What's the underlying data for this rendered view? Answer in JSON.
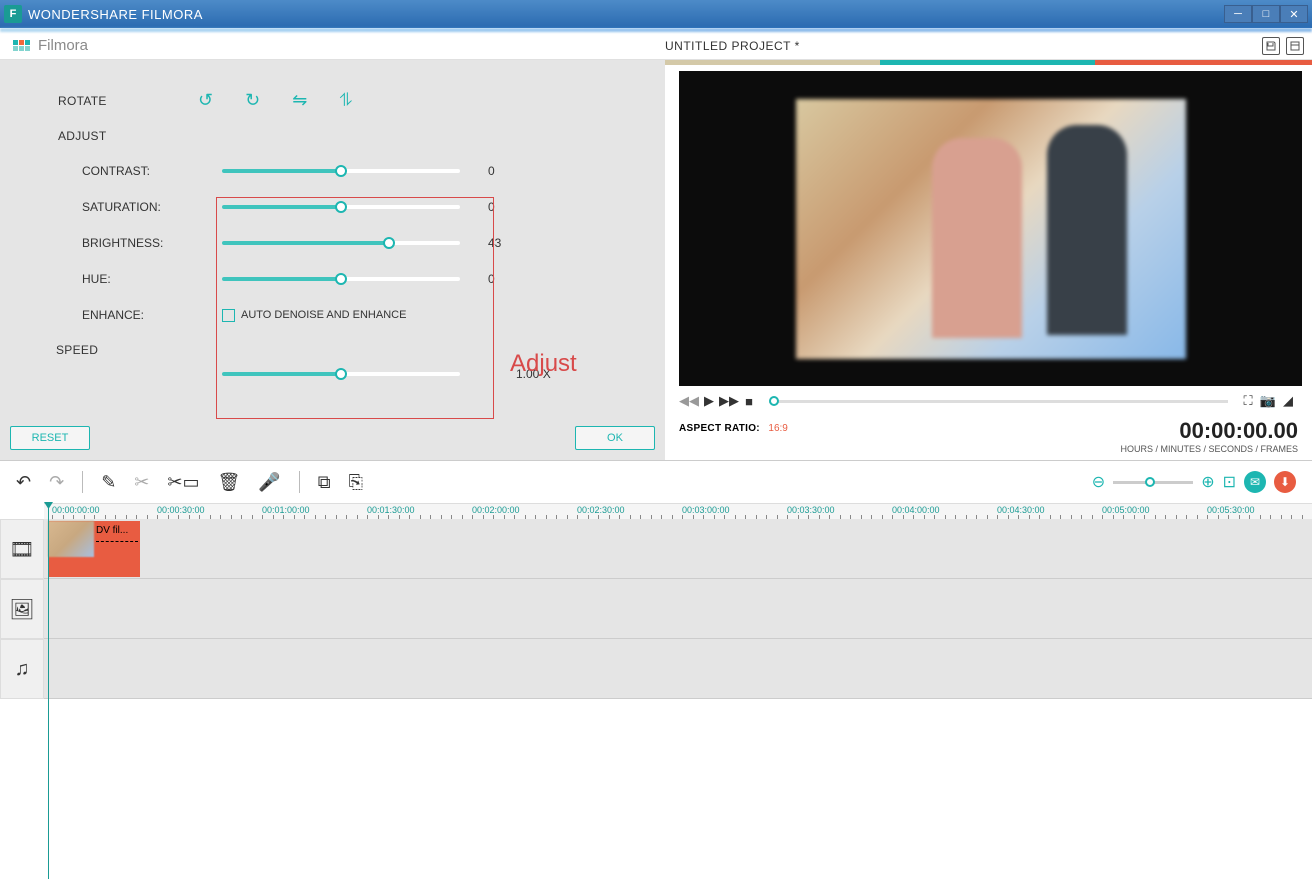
{
  "titlebar": {
    "app_name": "WONDERSHARE FILMORA"
  },
  "logo": {
    "text": "Filmora"
  },
  "project": {
    "title": "UNTITLED PROJECT *"
  },
  "sections": {
    "rotate": "ROTATE",
    "adjust": "ADJUST",
    "speed": "SPEED"
  },
  "sliders": {
    "contrast": {
      "label": "CONTRAST:",
      "value": "0",
      "pct": 50
    },
    "saturation": {
      "label": "SATURATION:",
      "value": "0",
      "pct": 50
    },
    "brightness": {
      "label": "BRIGHTNESS:",
      "value": "43",
      "pct": 70
    },
    "hue": {
      "label": "HUE:",
      "value": "0",
      "pct": 50
    },
    "enhance": {
      "label": "ENHANCE:",
      "checkbox": "AUTO DENOISE AND ENHANCE"
    },
    "speed": {
      "value": "1.00 X",
      "pct": 50
    }
  },
  "annotation": "Adjust",
  "buttons": {
    "reset": "RESET",
    "ok": "OK"
  },
  "aspect_ratio": {
    "label": "ASPECT RATIO:",
    "value": "16:9"
  },
  "timecode": {
    "value": "00:00:00.00",
    "caption": "HOURS / MINUTES / SECONDS / FRAMES"
  },
  "clip": {
    "name": "DV fil..."
  },
  "ruler": [
    "00:00:00:00",
    "00:00:30:00",
    "00:01:00:00",
    "00:01:30:00",
    "00:02:00:00",
    "00:02:30:00",
    "00:03:00:00",
    "00:03:30:00",
    "00:04:00:00",
    "00:04:30:00",
    "00:05:00:00",
    "00:05:30:00"
  ]
}
